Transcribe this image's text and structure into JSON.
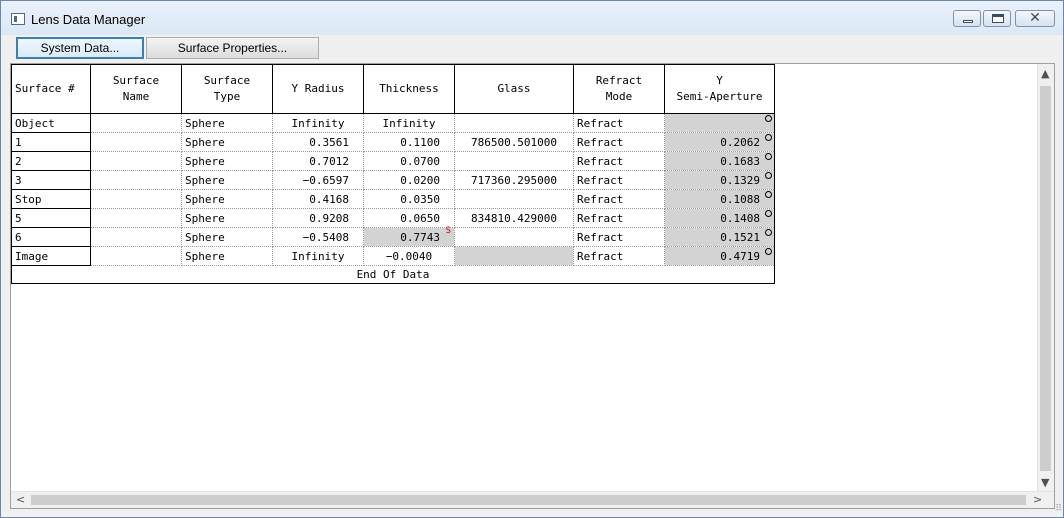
{
  "window": {
    "title": "Lens Data Manager",
    "close_glyph": "✕"
  },
  "toolbar": {
    "system_data": "System Data...",
    "surface_properties": "Surface Properties..."
  },
  "headers": {
    "surface_num": "Surface #",
    "surface_name": [
      "Surface",
      "Name"
    ],
    "surface_type": [
      "Surface",
      "Type"
    ],
    "y_radius": "Y Radius",
    "thickness": "Thickness",
    "glass": "Glass",
    "refract_mode": [
      "Refract",
      "Mode"
    ],
    "semi_aperture": [
      "Y",
      "Semi-Aperture"
    ]
  },
  "rows": [
    {
      "surface": "Object",
      "name": "",
      "type": "Sphere",
      "radius": "Infinity",
      "thickness": "Infinity",
      "glass": "",
      "mode": "Refract",
      "aperture": ""
    },
    {
      "surface": "1",
      "name": "",
      "type": "Sphere",
      "radius": "0.3561",
      "thickness": "0.1100",
      "glass": "786500.501000",
      "mode": "Refract",
      "aperture": "0.2062"
    },
    {
      "surface": "2",
      "name": "",
      "type": "Sphere",
      "radius": "0.7012",
      "thickness": "0.0700",
      "glass": "",
      "mode": "Refract",
      "aperture": "0.1683"
    },
    {
      "surface": "3",
      "name": "",
      "type": "Sphere",
      "radius": "−0.6597",
      "thickness": "0.0200",
      "glass": "717360.295000",
      "mode": "Refract",
      "aperture": "0.1329"
    },
    {
      "surface": "Stop",
      "name": "",
      "type": "Sphere",
      "radius": "0.4168",
      "thickness": "0.0350",
      "glass": "",
      "mode": "Refract",
      "aperture": "0.1088"
    },
    {
      "surface": "5",
      "name": "",
      "type": "Sphere",
      "radius": "0.9208",
      "thickness": "0.0650",
      "glass": "834810.429000",
      "mode": "Refract",
      "aperture": "0.1408"
    },
    {
      "surface": "6",
      "name": "",
      "type": "Sphere",
      "radius": "−0.5408",
      "thickness": "0.7743",
      "glass": "",
      "mode": "Refract",
      "aperture": "0.1521",
      "thickness_solve": "S"
    },
    {
      "surface": "Image",
      "name": "",
      "type": "Sphere",
      "radius": "Infinity",
      "thickness": "−0.0040",
      "glass": "",
      "mode": "Refract",
      "aperture": "0.4719"
    }
  ],
  "end_of_data": "End Of Data",
  "scroll": {
    "up": "▲",
    "down": "▼",
    "left": "<",
    "right": ">",
    "grip": "⠿"
  }
}
